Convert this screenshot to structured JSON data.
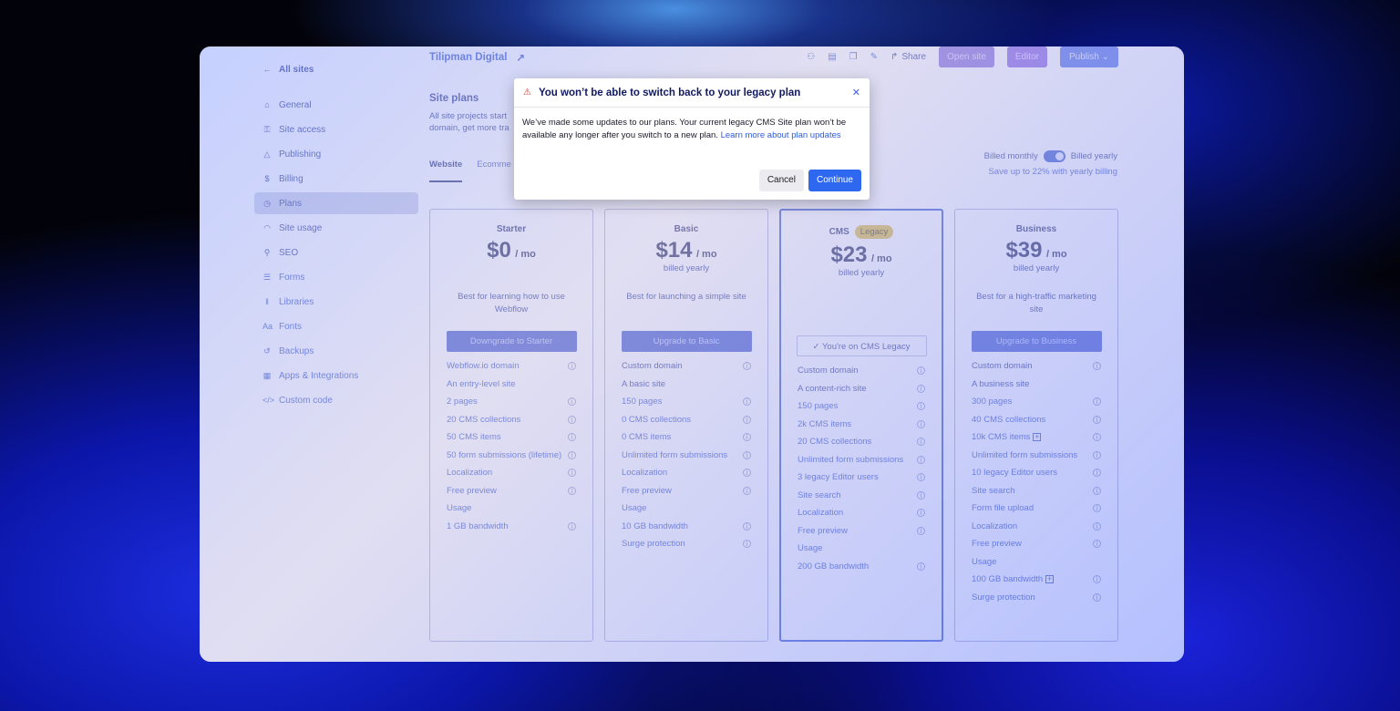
{
  "header": {
    "site_name": "Tilipman Digital",
    "share": "Share",
    "open_site": "Open site",
    "editor": "Editor",
    "publish": "Publish"
  },
  "sidebar": {
    "back": "All sites",
    "items": [
      {
        "label": "General",
        "icon": "home-icon"
      },
      {
        "label": "Site access",
        "icon": "key-icon"
      },
      {
        "label": "Publishing",
        "icon": "publish-icon"
      },
      {
        "label": "Billing",
        "icon": "dollar-icon"
      },
      {
        "label": "Plans",
        "icon": "plans-icon"
      },
      {
        "label": "Site usage",
        "icon": "gauge-icon"
      },
      {
        "label": "SEO",
        "icon": "search-icon"
      },
      {
        "label": "Forms",
        "icon": "forms-icon"
      },
      {
        "label": "Libraries",
        "icon": "library-icon"
      },
      {
        "label": "Fonts",
        "icon": "fonts-icon"
      },
      {
        "label": "Backups",
        "icon": "backup-icon"
      },
      {
        "label": "Apps & Integrations",
        "icon": "apps-icon"
      },
      {
        "label": "Custom code",
        "icon": "code-icon"
      }
    ]
  },
  "main": {
    "title": "Site plans",
    "desc_line1": "All site projects start",
    "desc_line2": "domain, get more tra",
    "tabs": [
      "Website",
      "Ecomme"
    ],
    "billed_monthly": "Billed monthly",
    "billed_yearly": "Billed yearly",
    "savings": "Save up to 22% with yearly billing"
  },
  "plans": [
    {
      "name": "Starter",
      "price": "$0",
      "per": "/ mo",
      "billed": "",
      "desc": "Best for learning how to use Webflow",
      "button": "Downgrade to Starter",
      "features": [
        {
          "t": "Webflow.io domain",
          "info": true
        },
        {
          "t": "An entry-level site",
          "info": false
        },
        {
          "t": "2 pages",
          "info": true
        },
        {
          "t": "20 CMS collections",
          "info": true
        },
        {
          "t": "50 CMS items",
          "info": true
        },
        {
          "t": "50 form submissions (lifetime)",
          "info": true
        },
        {
          "t": "Localization",
          "info": true
        },
        {
          "t": "Free preview",
          "info": true
        },
        {
          "t": "Usage",
          "info": false
        },
        {
          "t": "1 GB bandwidth",
          "info": true
        }
      ]
    },
    {
      "name": "Basic",
      "price": "$14",
      "per": "/ mo",
      "billed": "billed yearly",
      "desc": "Best for launching a simple site",
      "button": "Upgrade to Basic",
      "features": [
        {
          "t": "Custom domain",
          "info": true
        },
        {
          "t": "A basic site",
          "info": false
        },
        {
          "t": "150 pages",
          "info": true
        },
        {
          "t": "0 CMS collections",
          "info": true
        },
        {
          "t": "0 CMS items",
          "info": true
        },
        {
          "t": "Unlimited form submissions",
          "info": true
        },
        {
          "t": "Localization",
          "info": true
        },
        {
          "t": "Free preview",
          "info": true
        },
        {
          "t": "Usage",
          "info": false
        },
        {
          "t": "10 GB bandwidth",
          "info": true
        },
        {
          "t": "Surge protection",
          "info": true
        }
      ]
    },
    {
      "name": "CMS",
      "badge": "Legacy",
      "price": "$23",
      "per": "/ mo",
      "billed": "billed yearly",
      "desc": "",
      "button": "You're on CMS Legacy",
      "features": [
        {
          "t": "Custom domain",
          "info": true
        },
        {
          "t": "A content-rich site",
          "info": true
        },
        {
          "t": "150 pages",
          "info": true
        },
        {
          "t": "2k CMS items",
          "info": true
        },
        {
          "t": "20 CMS collections",
          "info": true
        },
        {
          "t": "Unlimited form submissions",
          "info": true
        },
        {
          "t": "3 legacy Editor users",
          "info": true
        },
        {
          "t": "Site search",
          "info": true
        },
        {
          "t": "Localization",
          "info": true
        },
        {
          "t": "Free preview",
          "info": true
        },
        {
          "t": "Usage",
          "info": false
        },
        {
          "t": "200 GB bandwidth",
          "info": true
        }
      ]
    },
    {
      "name": "Business",
      "price": "$39",
      "per": "/ mo",
      "billed": "billed yearly",
      "desc": "Best for a high-traffic marketing site",
      "button": "Upgrade to Business",
      "features": [
        {
          "t": "Custom domain",
          "info": true
        },
        {
          "t": "A business site",
          "info": false
        },
        {
          "t": "300 pages",
          "info": true
        },
        {
          "t": "40 CMS collections",
          "info": true
        },
        {
          "t": "10k CMS items",
          "info": true,
          "plus": true
        },
        {
          "t": "Unlimited form submissions",
          "info": true
        },
        {
          "t": "10 legacy Editor users",
          "info": true
        },
        {
          "t": "Site search",
          "info": true
        },
        {
          "t": "Form file upload",
          "info": true
        },
        {
          "t": "Localization",
          "info": true
        },
        {
          "t": "Free preview",
          "info": true
        },
        {
          "t": "Usage",
          "info": false
        },
        {
          "t": "100 GB bandwidth",
          "info": true,
          "plus": true
        },
        {
          "t": "Surge protection",
          "info": true
        }
      ]
    }
  ],
  "modal": {
    "title": "You won’t be able to switch back to your legacy plan",
    "body": "We’ve made some updates to our plans. Your current legacy CMS Site plan won’t be available any longer after you switch to a new plan.",
    "link": "Learn more about plan updates",
    "cancel": "Cancel",
    "continue": "Continue"
  }
}
